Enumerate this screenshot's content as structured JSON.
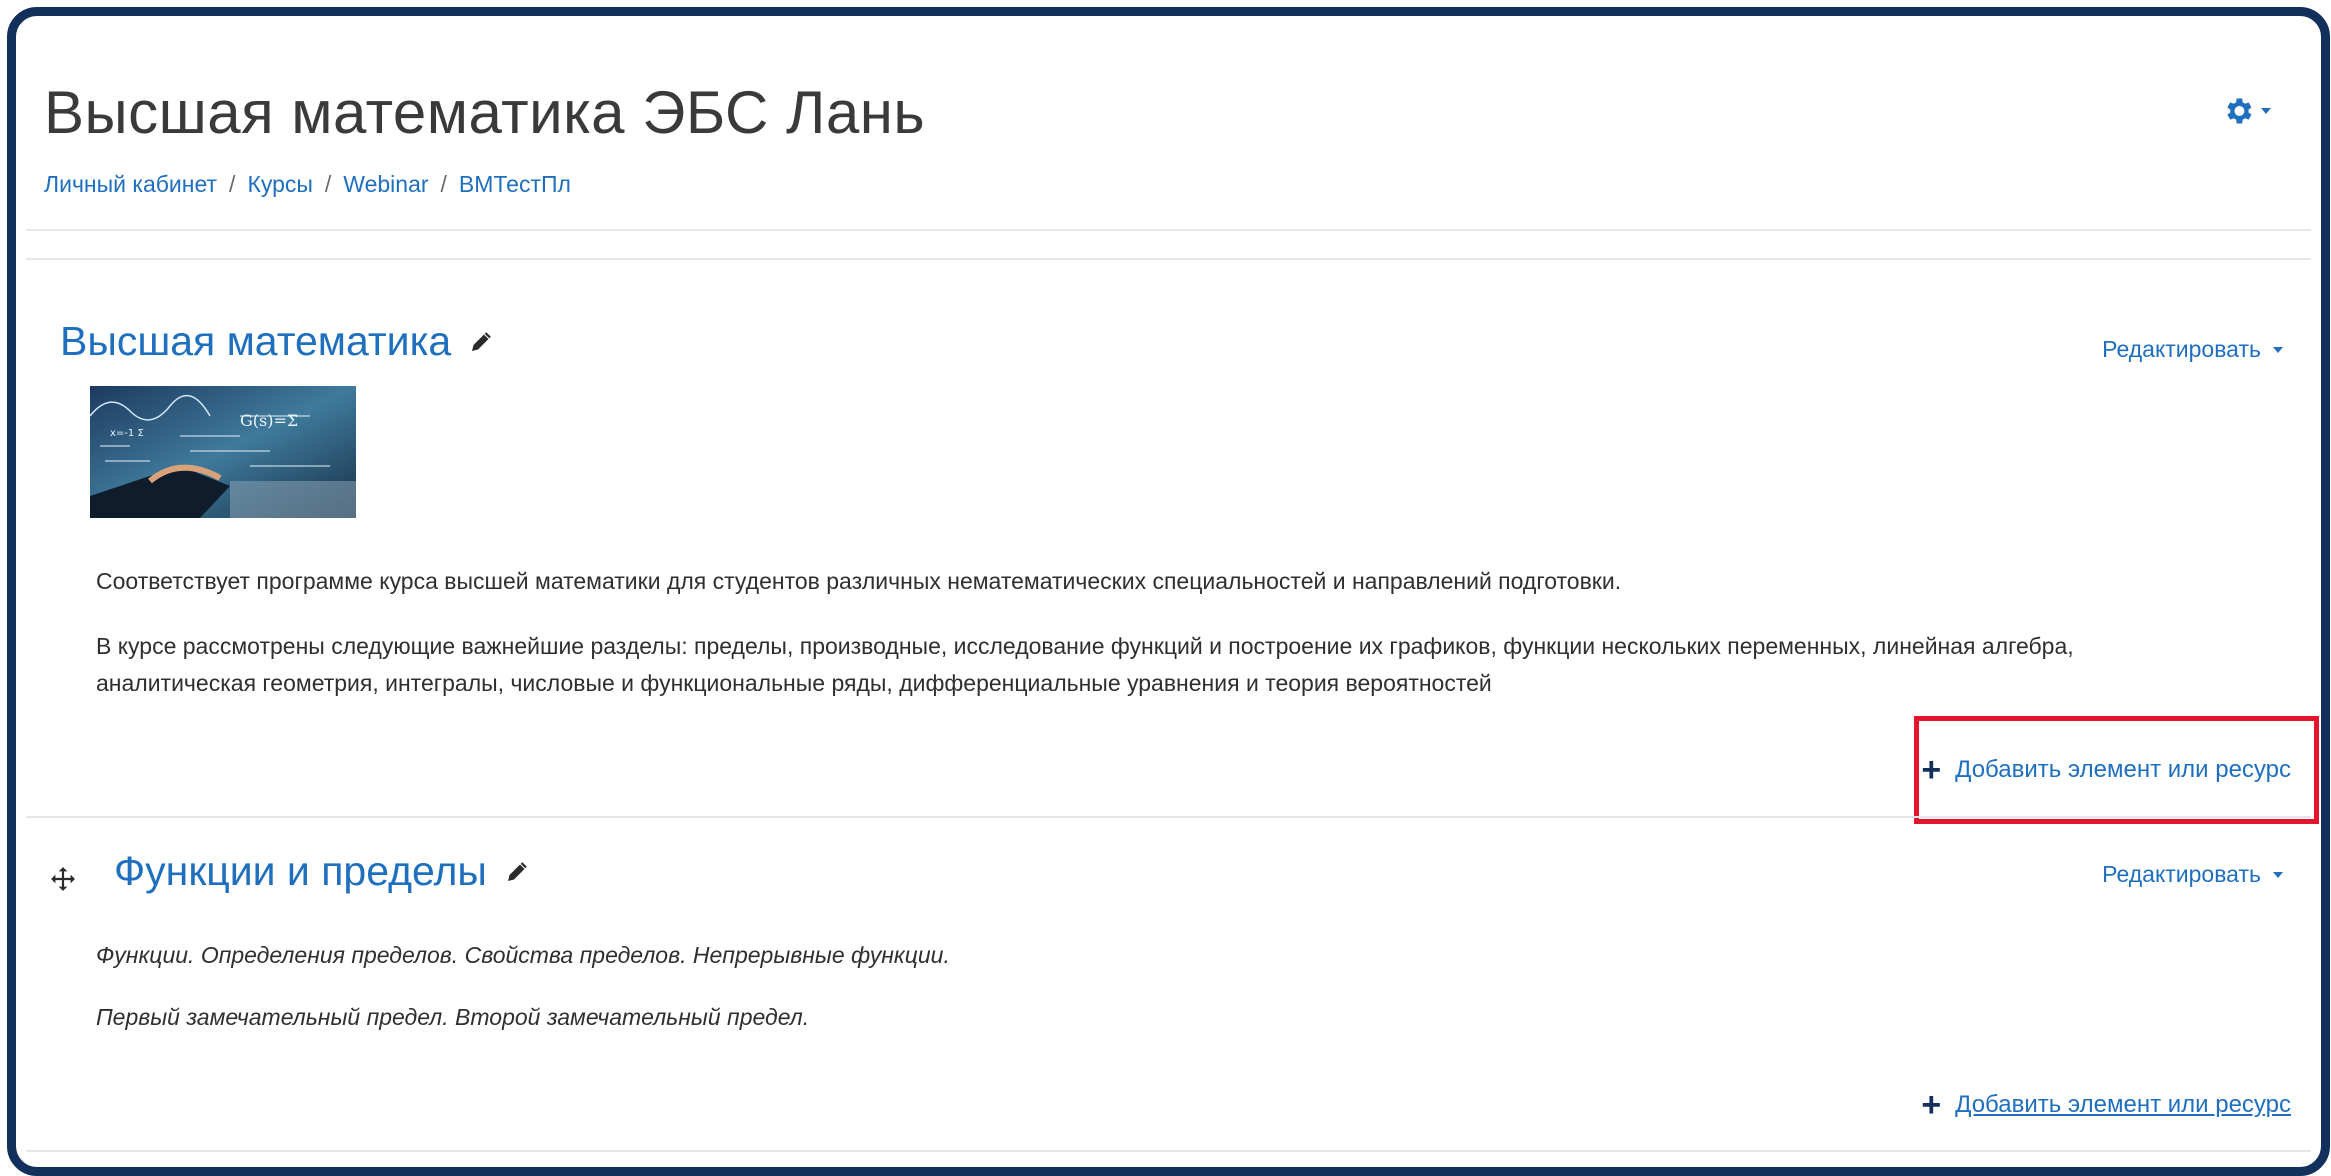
{
  "page": {
    "title": "Высшая математика ЭБС Лань",
    "settings_icon": "gear-icon"
  },
  "breadcrumb": [
    {
      "label": "Личный кабинет"
    },
    {
      "label": "Курсы"
    },
    {
      "label": "Webinar"
    },
    {
      "label": "ВМТестПл"
    }
  ],
  "colors": {
    "frame": "#13305d",
    "link": "#1f6fbf",
    "highlight": "#e3162d"
  },
  "sections": [
    {
      "title": "Высшая математика",
      "edit_label": "Редактировать",
      "image_icon": "course-image",
      "paragraphs": [
        "Соответствует программе курса высшей математики для студентов различных нематематических специальностей и направлений подготовки.",
        "В курсе рассмотрены следующие важнейшие разделы: пределы, производные, исследование функций и построение их графиков, функции нескольких переменных, линейная алгебра,",
        "аналитическая геометрия, интегралы, числовые и функциональные ряды, дифференциальные уравнения и теория вероятностей"
      ],
      "add_label": "Добавить элемент или ресурс"
    },
    {
      "title": "Функции и пределы",
      "edit_label": "Редактировать",
      "paragraphs": [
        "Функции. Определения пределов. Свойства пределов. Непрерывные функции.",
        "Первый замечательный предел. Второй замечательный предел."
      ],
      "add_label": "Добавить элемент или ресурс"
    }
  ]
}
